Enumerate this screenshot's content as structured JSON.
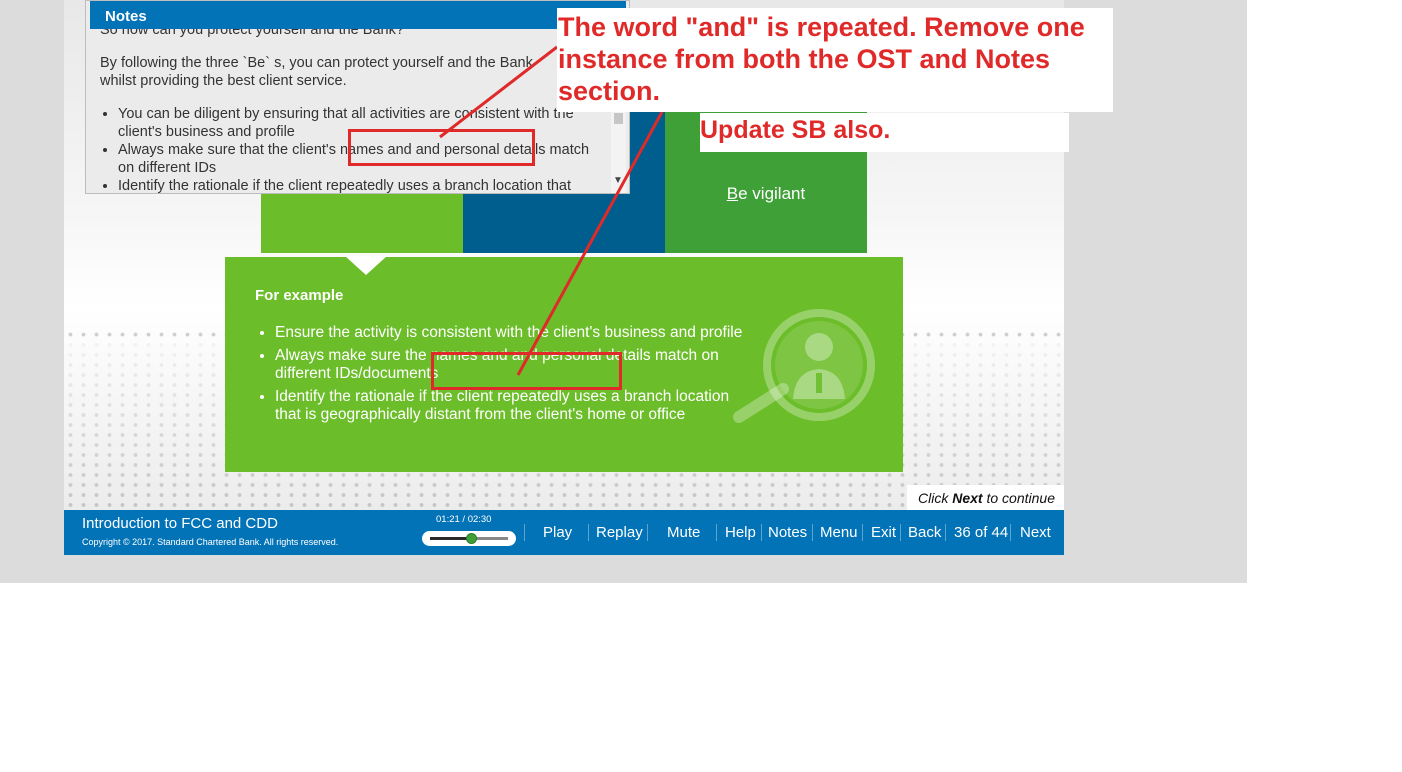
{
  "notes_panel": {
    "title": "Notes",
    "cutoff_line": "So now can you protect yourself and the Bank?",
    "paragraph": "By following the three `Be` s, you can protect yourself and the Bank whilst providing the best client service.",
    "items": [
      "You can be diligent by ensuring that all activities are consistent with the client's business and profile",
      "Always make sure that the client's names and and personal details match on different IDs",
      "Identify the rationale if the client repeatedly uses a branch location that"
    ]
  },
  "tiles": {
    "vigilant_first": "B",
    "vigilant_rest": "e vigilant"
  },
  "example": {
    "title": "For example",
    "items": [
      "Ensure the activity is consistent with the client's business and profile",
      "Always make sure the names and and personal details match on different IDs/documents",
      "Identify the rationale if the client repeatedly uses a branch location that is geographically distant from the client's home or office"
    ]
  },
  "continue_hint": {
    "pre": "Click ",
    "bold": "Next",
    "post": " to continue"
  },
  "player": {
    "course_title": "Introduction to FCC and CDD",
    "copyright": "Copyright © 2017. Standard Chartered Bank. All rights reserved.",
    "time": "01:21 / 02:30",
    "progress": 0.54,
    "buttons": {
      "play": "Play",
      "replay": "Replay",
      "mute": "Mute",
      "help": "Help",
      "notes": "Notes",
      "menu": "Menu",
      "exit": "Exit",
      "back": "Back",
      "next": "Next"
    },
    "page_counter": "36 of 44"
  },
  "annotations": {
    "callout_main": "The word \"and\" is repeated. Remove one instance from both the OST and Notes section.",
    "callout_secondary": "Update SB also.",
    "color": "#e02a2a"
  },
  "colors": {
    "brand_blue": "#0273b7",
    "green": "#6cbd2a",
    "dark_green": "#3ea037",
    "teal": "#005e8e"
  }
}
